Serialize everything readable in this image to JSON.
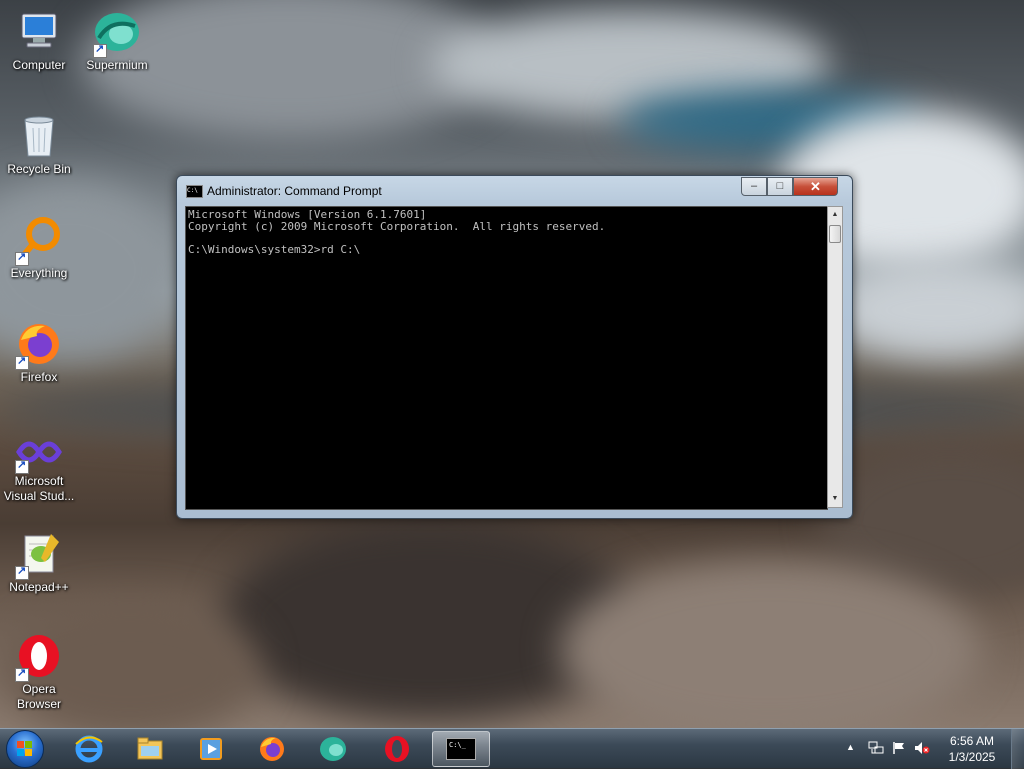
{
  "desktop": {
    "icons": [
      {
        "label": "Computer"
      },
      {
        "label": "Supermium"
      },
      {
        "label": "Recycle Bin"
      },
      {
        "label": "Everything"
      },
      {
        "label": "Firefox"
      },
      {
        "label": "Microsoft Visual Stud..."
      },
      {
        "label": "Notepad++"
      },
      {
        "label": "Opera Browser"
      }
    ]
  },
  "window": {
    "title": "Administrator: Command Prompt",
    "title_icon_text": "C:\\",
    "controls": {
      "minimize": "–",
      "maximize": "□",
      "close": "✕"
    },
    "console_lines": [
      "Microsoft Windows [Version 6.1.7601]",
      "Copyright (c) 2009 Microsoft Corporation.  All rights reserved.",
      "",
      "C:\\Windows\\system32>rd C:\\"
    ]
  },
  "taskbar": {
    "pinned": [
      {
        "icon": "internet-explorer-icon"
      },
      {
        "icon": "file-explorer-icon"
      },
      {
        "icon": "media-player-icon"
      },
      {
        "icon": "firefox-icon"
      },
      {
        "icon": "supermium-icon"
      },
      {
        "icon": "opera-icon"
      },
      {
        "icon": "command-prompt-icon",
        "active": true
      }
    ],
    "cmd_icon_text": "C:\\_",
    "tray": {
      "time": "6:56 AM",
      "date": "1/3/2025"
    }
  },
  "colors": {
    "console_bg": "#000000",
    "console_fg": "#c0c0c0",
    "close_button": "#c7503a",
    "taskbar": "#3c4a58"
  }
}
